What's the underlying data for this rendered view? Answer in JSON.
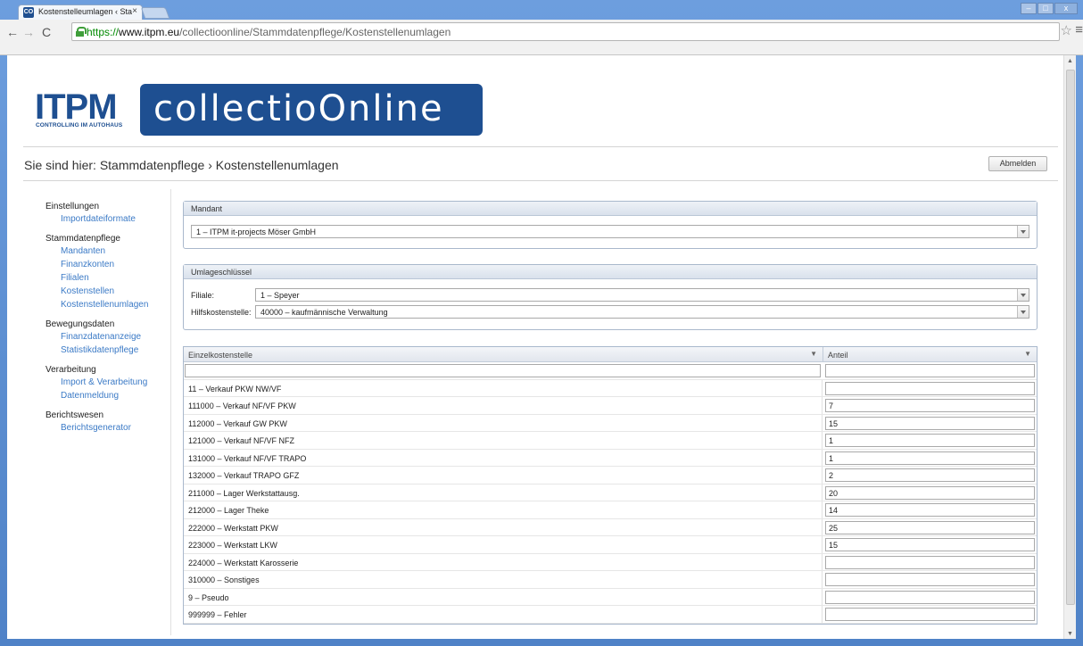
{
  "browser": {
    "tab_title": "Kostenstelleumlagen ‹ Sta",
    "tab_favicon": "CO",
    "url_scheme": "https://",
    "url_host": "www.itpm.eu",
    "url_path": "/collectioonline/Stammdatenpflege/Kostenstellenumlagen"
  },
  "header": {
    "logo_text": "ITPM",
    "logo_subtitle": "CONTROLLING IM AUTOHAUS",
    "product_name": "collectioOnline",
    "breadcrumb": "Sie sind hier: Stammdatenpflege › Kostenstellenumlagen",
    "logout_label": "Abmelden",
    "brand_color": "#1e4f91"
  },
  "sidebar": {
    "groups": [
      {
        "heading": "Einstellungen",
        "items": [
          "Importdateiformate"
        ]
      },
      {
        "heading": "Stammdatenpflege",
        "items": [
          "Mandanten",
          "Finanzkonten",
          "Filialen",
          "Kostenstellen",
          "Kostenstellenumlagen"
        ]
      },
      {
        "heading": "Bewegungsdaten",
        "items": [
          "Finanzdatenanzeige",
          "Statistikdatenpflege"
        ]
      },
      {
        "heading": "Verarbeitung",
        "items": [
          "Import & Verarbeitung",
          "Datenmeldung"
        ]
      },
      {
        "heading": "Berichtswesen",
        "items": [
          "Berichtsgenerator"
        ]
      }
    ]
  },
  "mandant": {
    "title": "Mandant",
    "selected": "1 – ITPM it-projects Möser GmbH"
  },
  "umlage": {
    "title": "Umlageschlüssel",
    "filiale_label": "Filiale:",
    "filiale_selected": "1 – Speyer",
    "hilfs_label": "Hilfskostenstelle:",
    "hilfs_selected": "40000 – kaufmännische Verwaltung"
  },
  "grid": {
    "col_kostenstelle": "Einzelkostenstelle",
    "col_anteil": "Anteil",
    "rows": [
      {
        "name": "11 – Verkauf PKW NW/VF",
        "anteil": ""
      },
      {
        "name": "111000 – Verkauf NF/VF PKW",
        "anteil": "7"
      },
      {
        "name": "112000 – Verkauf GW PKW",
        "anteil": "15"
      },
      {
        "name": "121000 – Verkauf NF/VF NFZ",
        "anteil": "1"
      },
      {
        "name": "131000 – Verkauf NF/VF TRAPO",
        "anteil": "1"
      },
      {
        "name": "132000 – Verkauf TRAPO GFZ",
        "anteil": "2"
      },
      {
        "name": "211000 – Lager Werkstattausg.",
        "anteil": "20"
      },
      {
        "name": "212000 – Lager Theke",
        "anteil": "14"
      },
      {
        "name": "222000 – Werkstatt PKW",
        "anteil": "25"
      },
      {
        "name": "223000 – Werkstatt LKW",
        "anteil": "15"
      },
      {
        "name": "224000 – Werkstatt Karosserie",
        "anteil": ""
      },
      {
        "name": "310000 – Sonstiges",
        "anteil": ""
      },
      {
        "name": "9 – Pseudo",
        "anteil": ""
      },
      {
        "name": "999999 – Fehler",
        "anteil": ""
      }
    ]
  }
}
